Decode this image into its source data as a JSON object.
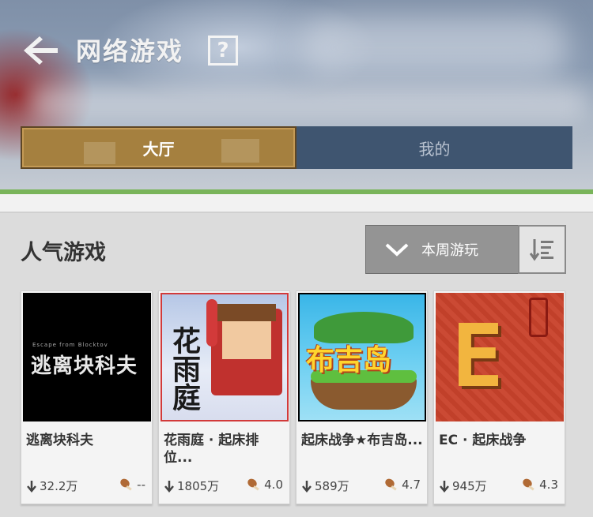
{
  "header": {
    "title": "网络游戏",
    "help_symbol": "?"
  },
  "tabs": [
    {
      "label": "大厅",
      "active": true
    },
    {
      "label": "我的",
      "active": false
    }
  ],
  "section": {
    "title": "人气游戏",
    "sort_selected": "本周游玩"
  },
  "cards": [
    {
      "name": "逃离块科夫",
      "thumb_text": "逃离块科夫",
      "thumb_small_text": "Escape from Blocktov",
      "downloads": "32.2万",
      "rating": "--"
    },
    {
      "name": "花雨庭 · 起床排位...",
      "thumb_text": "花雨庭",
      "downloads": "1805万",
      "rating": "4.0"
    },
    {
      "name": "起床战争★布吉岛...",
      "thumb_text": "布吉岛",
      "downloads": "589万",
      "rating": "4.7"
    },
    {
      "name": "EC · 起床战争",
      "thumb_text": "E",
      "downloads": "945万",
      "rating": "4.3"
    }
  ],
  "colors": {
    "tab_active": "#a5803f",
    "tab_inactive": "#3f5570",
    "accent_green": "#79b45a",
    "sort_bg": "#949494"
  }
}
